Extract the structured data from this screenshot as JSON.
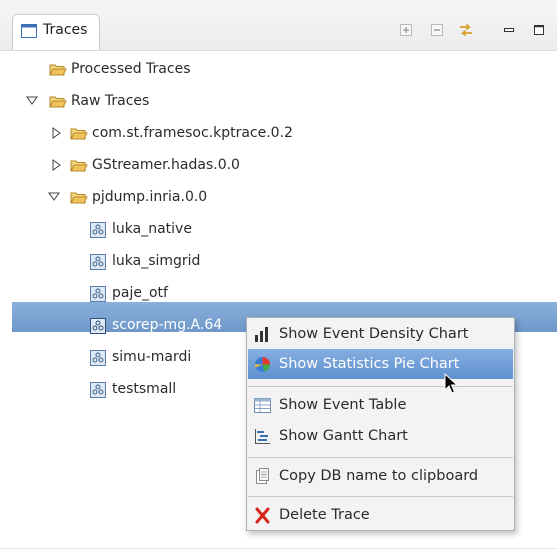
{
  "view": {
    "tab_title": "Traces"
  },
  "tree": {
    "processed": "Processed Traces",
    "raw": "Raw Traces",
    "groups": [
      "com.st.framesoc.kptrace.0.2",
      "GStreamer.hadas.0.0",
      "pjdump.inria.0.0"
    ],
    "traces": [
      "luka_native",
      "luka_simgrid",
      "paje_otf",
      "scorep-mg.A.64",
      "simu-mardi",
      "testsmall"
    ],
    "selected": "scorep-mg.A.64"
  },
  "context_menu": {
    "items": [
      {
        "label": "Show Event Density Chart",
        "icon": "bar-chart-icon"
      },
      {
        "label": "Show Statistics Pie Chart",
        "icon": "pie-chart-icon",
        "highlighted": true
      },
      {
        "label": "Show Event Table",
        "icon": "table-icon"
      },
      {
        "label": "Show Gantt Chart",
        "icon": "gantt-icon"
      },
      {
        "label": "Copy DB name to clipboard",
        "icon": "clipboard-icon"
      },
      {
        "label": "Delete Trace",
        "icon": "delete-icon"
      }
    ]
  },
  "colors": {
    "selection": "#7aa3d3",
    "menu_highlight": "#6f9bd6",
    "folder": "#e8b84a",
    "delete": "#d8251b"
  }
}
